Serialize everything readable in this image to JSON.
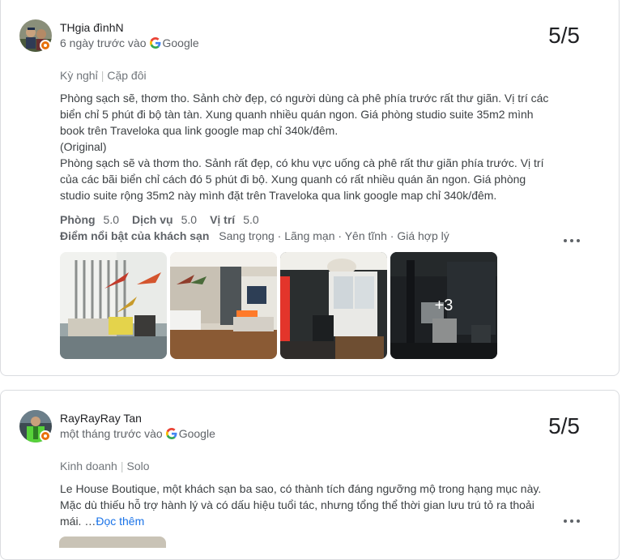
{
  "reviews": [
    {
      "author": "THgia đìnhN",
      "when": "6 ngày trước vào",
      "source": "Google",
      "score": "5/5",
      "trip_type": "Kỳ nghỉ",
      "traveler_type": "Cặp đôi",
      "text_lines": [
        "Phòng sạch sẽ, thơm tho. Sảnh chờ đẹp, có người dùng cà phê phía trước rất thư giãn. Vị trí các",
        "biển chỉ 5 phút đi bộ tàn tàn. Xung quanh nhiều quán ngon. Giá phòng studio suite 35m2 mình",
        "book trên Traveloka qua link google map chỉ 340k/đêm.",
        "(Original)",
        "Phòng sạch sẽ và thơm tho. Sảnh rất đẹp, có khu vực uống cà phê rất thư giãn phía trước. Vị trí",
        "của các bãi biển chỉ cách đó 5 phút đi bộ. Xung quanh có rất nhiều quán ăn ngon. Giá phòng",
        "studio suite rộng 35m2 này mình đặt trên Traveloka qua link google map chỉ 340k/đêm."
      ],
      "ratings": [
        {
          "label": "Phòng",
          "value": "5.0"
        },
        {
          "label": "Dịch vụ",
          "value": "5.0"
        },
        {
          "label": "Vị trí",
          "value": "5.0"
        }
      ],
      "highlights_label": "Điểm nổi bật của khách sạn",
      "highlights": [
        "Sang trọng",
        "Lãng mạn",
        "Yên tĩnh",
        "Giá hợp lý"
      ],
      "more_photos": "+3"
    },
    {
      "author": "RayRayRay Tan",
      "when": "một tháng trước vào",
      "source": "Google",
      "score": "5/5",
      "trip_type": "Kinh doanh",
      "traveler_type": "Solo",
      "text_lines": [
        "Le House Boutique, một khách sạn ba sao, có thành tích đáng ngưỡng mộ trong hạng mục này.",
        "Mặc dù thiếu hỗ trợ hành lý và có dấu hiệu tuổi tác, nhưng tổng thể thời gian lưu trú tỏ ra thoải",
        "mái. …"
      ],
      "read_more": "Đọc thêm"
    }
  ],
  "colors": {
    "link": "#1a73e8",
    "secondary_text": "#5f6368",
    "badge": "#e8710a",
    "border": "#dadce0"
  }
}
